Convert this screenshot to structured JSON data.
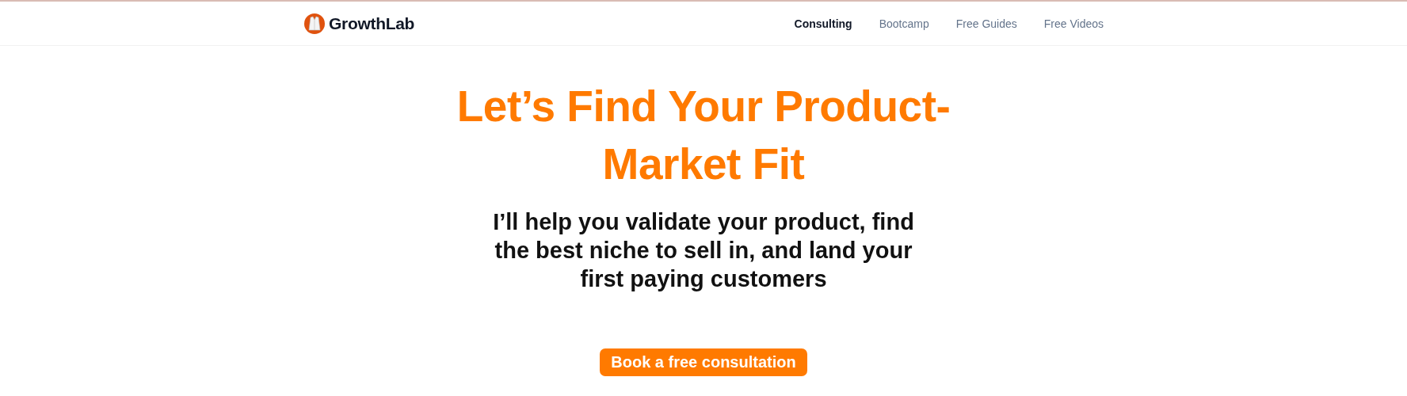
{
  "header": {
    "logo": "GrowthLab",
    "nav": [
      {
        "label": "Consulting",
        "selected": true
      },
      {
        "label": "Bootcamp",
        "selected": false
      },
      {
        "label": "Free Guides",
        "selected": false
      },
      {
        "label": "Free Videos",
        "selected": false
      }
    ]
  },
  "hero": {
    "title": "Let’s Find Your Product-Market Fit",
    "subtitle": "I’ll help you validate your product, find the best niche to sell in, and land your first paying customers",
    "cta": "Book a free consultation"
  }
}
